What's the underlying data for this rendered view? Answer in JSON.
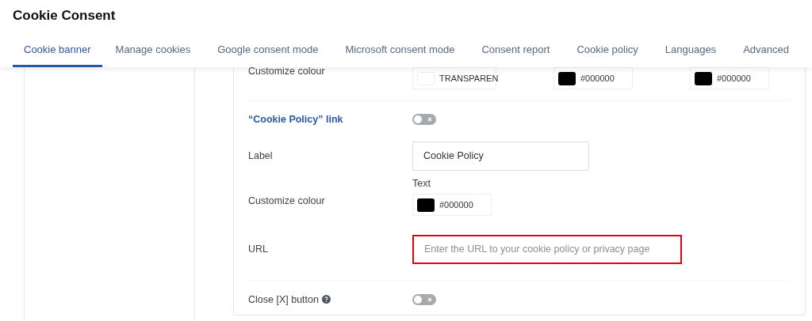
{
  "page_title": "Cookie Consent",
  "tabs": [
    {
      "label": "Cookie banner",
      "selected": true
    },
    {
      "label": "Manage cookies",
      "selected": false
    },
    {
      "label": "Google consent mode",
      "selected": false
    },
    {
      "label": "Microsoft consent mode",
      "selected": false
    },
    {
      "label": "Consent report",
      "selected": false
    },
    {
      "label": "Cookie policy",
      "selected": false
    },
    {
      "label": "Languages",
      "selected": false
    },
    {
      "label": "Advanced",
      "selected": false
    }
  ],
  "rows": [
    {
      "kind": "swatches",
      "label": "Customize colour",
      "swatches": [
        {
          "value": "TRANSPAREN",
          "color": "#ffffff"
        },
        {
          "value": "#000000",
          "color": "#000000"
        },
        {
          "value": "#000000",
          "color": "#000000"
        }
      ]
    },
    {
      "kind": "divider"
    },
    {
      "kind": "toggle",
      "label": "“Cookie Policy” link",
      "heading": true,
      "on": false
    },
    {
      "kind": "input",
      "label": "Label",
      "value": "Cookie Policy",
      "highlighted": false
    },
    {
      "kind": "swatches",
      "label": "Customize colour",
      "caption": "Text",
      "swatches": [
        {
          "value": "#000000",
          "color": "#000000"
        }
      ]
    },
    {
      "kind": "input",
      "label": "URL",
      "placeholder": "Enter the URL to your cookie policy or privacy page",
      "highlighted": true
    },
    {
      "kind": "divider"
    },
    {
      "kind": "toggle",
      "label": "Close [X] button",
      "heading": false,
      "help": true,
      "on": false
    }
  ]
}
